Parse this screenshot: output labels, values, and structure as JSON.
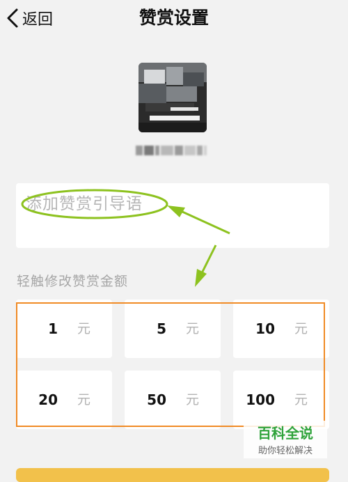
{
  "header": {
    "back_label": "返回",
    "title": "赞赏设置"
  },
  "guide": {
    "placeholder": "添加赞赏引导语"
  },
  "amount_section": {
    "label": "轻触修改赞赏金额",
    "unit": "元",
    "amounts": [
      "1",
      "5",
      "10",
      "20",
      "50",
      "100"
    ]
  },
  "watermark": {
    "title": "百科全说",
    "subtitle": "助你轻松解决"
  },
  "colors": {
    "highlight_green": "#8dc21f",
    "highlight_orange": "#f08a24",
    "button_yellow": "#f2c14b"
  },
  "icons": {
    "back": "chevron-left-icon"
  }
}
